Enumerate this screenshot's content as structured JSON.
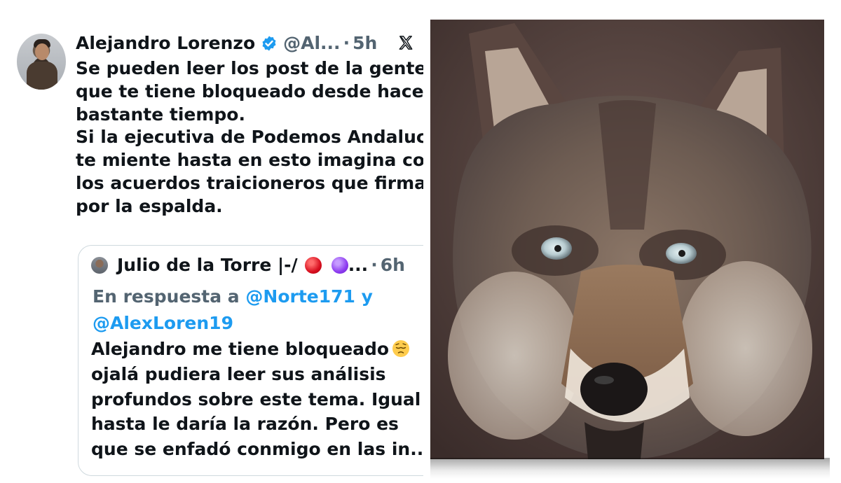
{
  "tweet": {
    "author_name": "Alejandro Lorenzo",
    "handle": "@Al...",
    "dot": "·",
    "time_ago": "5h",
    "text_lines": [
      "Se pueden leer los post de la gente",
      "que te tiene bloqueado desde hace",
      "bastante tiempo.",
      "Si la ejecutiva de Podemos Andalucía",
      "te miente hasta en esto imagina con",
      "los acuerdos traicioneros que firman",
      "por la espalda."
    ]
  },
  "quoted_tweet": {
    "author_name": "Julio de la Torre |-/",
    "ellipsis": "...",
    "dot": "·",
    "time_ago": "6h",
    "reply_prefix": "En respuesta a",
    "reply_mention_1": "@Norte171",
    "reply_conjunction": "y",
    "reply_mention_2": "@AlexLoren19",
    "text_lines": [
      "Alejandro me tiene bloqueado",
      "ojalá pudiera leer sus análisis",
      "profundos sobre este tema. Igual",
      "hasta le daría la razón. Pero es",
      "que se enfadó conmigo en las in..."
    ]
  },
  "icons": {
    "verified": "verified-badge-icon",
    "platform": "x-logo-icon",
    "emoji_1": "red-circle-icon",
    "emoji_2": "purple-circle-icon",
    "emoji_3": "pensive-emoji-icon"
  },
  "colors": {
    "text_primary": "#0f1419",
    "text_secondary": "#536471",
    "link": "#1d9bf0",
    "verified": "#1d9bf0",
    "border": "#cfd9de"
  },
  "image": {
    "subject": "wolf-photo"
  }
}
